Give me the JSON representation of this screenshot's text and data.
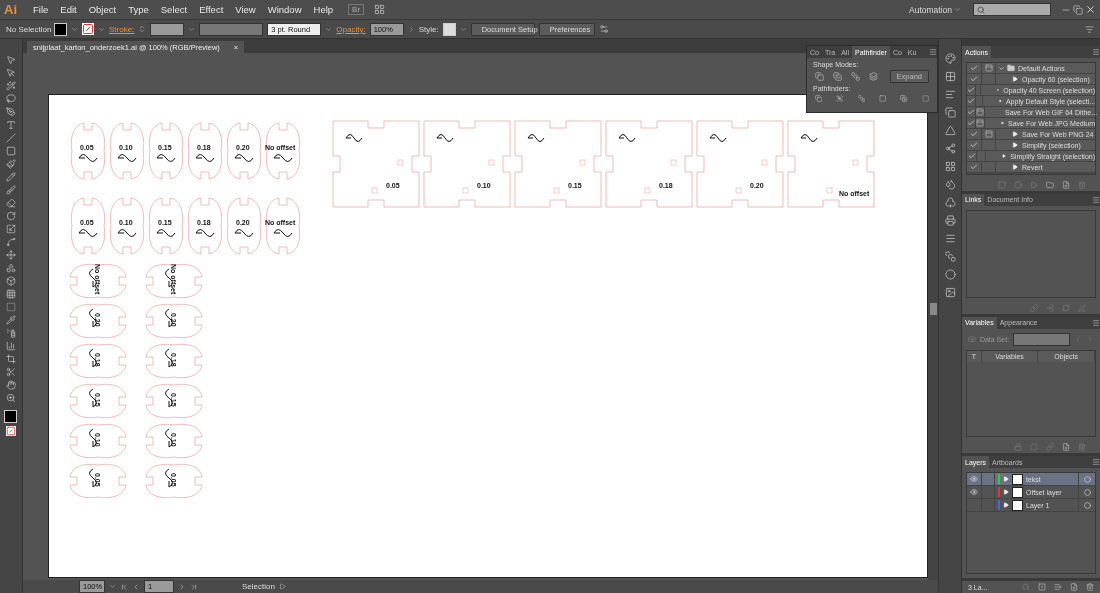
{
  "app": {
    "logo": "Ai",
    "menu": [
      "File",
      "Edit",
      "Object",
      "Type",
      "Select",
      "Effect",
      "View",
      "Window",
      "Help"
    ],
    "bridge": "Br",
    "workspace": "Automation"
  },
  "control_bar": {
    "selection": "No Selection",
    "stroke_label": "Stroke:",
    "brush": "3 pt. Round",
    "opacity_label": "Opacity:",
    "opacity": "100%",
    "style_label": "Style:",
    "buttons": [
      "Document Setup",
      "Preferences"
    ]
  },
  "document_tab": {
    "title": "snijplaat_karton_onderzoek1.ai @ 100% (RGB/Preview)",
    "close": "×"
  },
  "artboard": {
    "oval_rows": [
      [
        "0.05",
        "0.10",
        "0.15",
        "0.18",
        "0.20",
        "No offset"
      ],
      [
        "0.05",
        "0.10",
        "0.15",
        "0.18",
        "0.20",
        "No offset"
      ]
    ],
    "square_pieces": [
      "0.05",
      "0.10",
      "0.15",
      "0.18",
      "0.20",
      "No offset"
    ],
    "rotated_columns": [
      [
        "No offset",
        "0.20",
        "0.18",
        "0.15",
        "0.10",
        "0.05"
      ],
      [
        "No offset",
        "0.20",
        "0.18",
        "0.15",
        "0.10",
        "0.05"
      ]
    ]
  },
  "pathfinder_panel": {
    "tabs": [
      {
        "label": "Co",
        "selected": false
      },
      {
        "label": "Tra",
        "selected": false
      },
      {
        "label": "Ali",
        "selected": false
      },
      {
        "label": "Pathfinder",
        "selected": true
      },
      {
        "label": "Co",
        "selected": false
      },
      {
        "label": "Ku",
        "selected": false
      }
    ],
    "shape_modes_label": "Shape Modes:",
    "expand_button": "Expand",
    "pathfinders_label": "Pathfinders:"
  },
  "actions_panel": {
    "tabs": [
      {
        "label": "Actions",
        "selected": true
      }
    ],
    "items": [
      {
        "label": "Default Actions",
        "kind": "set",
        "checked": true,
        "dialog": true
      },
      {
        "label": "Opacity 60 (selection)",
        "kind": "action",
        "checked": true,
        "dialog": false
      },
      {
        "label": "Opacity 40 Screen (selection)",
        "kind": "action",
        "checked": true,
        "dialog": false
      },
      {
        "label": "Apply Default Style (selecti...",
        "kind": "action",
        "checked": true,
        "dialog": false
      },
      {
        "label": "Save For Web GIF 64 Dithe...",
        "kind": "action",
        "checked": true,
        "dialog": true
      },
      {
        "label": "Save For Web JPG Medium",
        "kind": "action",
        "checked": true,
        "dialog": true
      },
      {
        "label": "Save For Web PNG 24",
        "kind": "action",
        "checked": true,
        "dialog": true
      },
      {
        "label": "Simplify (selection)",
        "kind": "action",
        "checked": true,
        "dialog": false
      },
      {
        "label": "Simplify Straight (selection)",
        "kind": "action",
        "checked": true,
        "dialog": false
      },
      {
        "label": "Revert",
        "kind": "action",
        "checked": true,
        "dialog": false
      }
    ]
  },
  "links_panel": {
    "tabs": [
      {
        "label": "Links",
        "selected": true
      },
      {
        "label": "Document Info",
        "selected": false
      }
    ]
  },
  "variables_panel": {
    "tabs": [
      {
        "label": "Variables",
        "selected": true
      },
      {
        "label": "Appearance",
        "selected": false
      }
    ],
    "data_set_label": "Data Set:",
    "columns": [
      "T",
      "Variables",
      "Objects"
    ]
  },
  "layers_panel": {
    "tabs": [
      {
        "label": "Layers",
        "selected": true
      },
      {
        "label": "Artboards",
        "selected": false
      }
    ],
    "layers": [
      {
        "name": "tekst",
        "color": "#33cc33",
        "visible": true,
        "selected": true
      },
      {
        "name": "Offset layer",
        "color": "#ee3333",
        "visible": true,
        "selected": false
      },
      {
        "name": "Layer 1",
        "color": "#4466ee",
        "visible": false,
        "selected": false
      }
    ],
    "count": "3 La..."
  },
  "status_bar": {
    "zoom": "100%",
    "page": "1",
    "tool": "Selection"
  }
}
